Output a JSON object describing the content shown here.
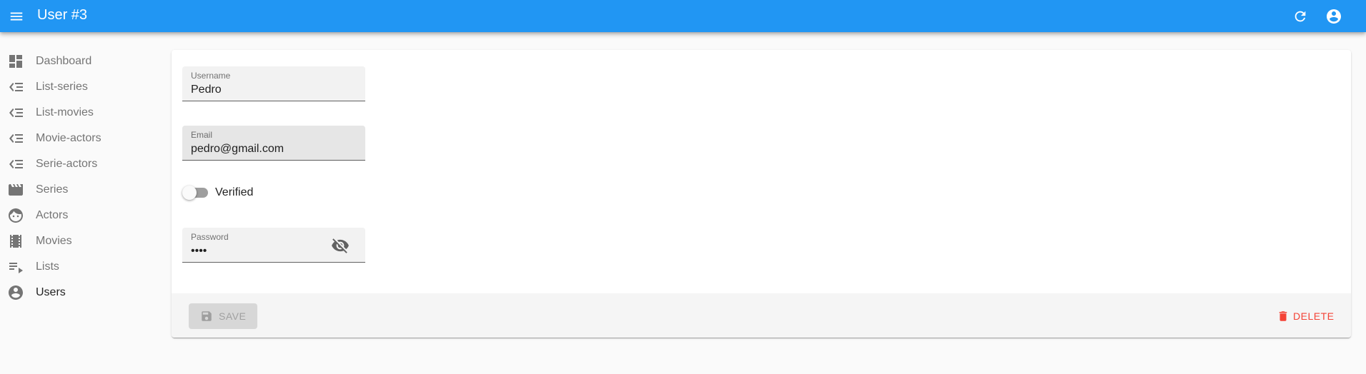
{
  "appbar": {
    "title": "User #3",
    "icons": {
      "menu": "menu-icon",
      "refresh": "refresh-icon",
      "account": "account-circle-icon"
    },
    "color": "#2196f3"
  },
  "sidebar": {
    "items": [
      {
        "label": "Dashboard",
        "icon": "dashboard-icon"
      },
      {
        "label": "List-series",
        "icon": "list-icon"
      },
      {
        "label": "List-movies",
        "icon": "list-icon"
      },
      {
        "label": "Movie-actors",
        "icon": "list-icon"
      },
      {
        "label": "Serie-actors",
        "icon": "list-icon"
      },
      {
        "label": "Series",
        "icon": "movie-clapper-icon"
      },
      {
        "label": "Actors",
        "icon": "face-icon"
      },
      {
        "label": "Movies",
        "icon": "film-strip-icon"
      },
      {
        "label": "Lists",
        "icon": "playlist-icon"
      },
      {
        "label": "Users",
        "icon": "account-circle-icon",
        "active": true
      }
    ]
  },
  "form": {
    "username": {
      "label": "Username",
      "value": "Pedro"
    },
    "email": {
      "label": "Email",
      "value": "pedro@gmail.com"
    },
    "verified": {
      "label": "Verified",
      "checked": false
    },
    "password": {
      "label": "Password",
      "value": "••••",
      "icon": "visibility-off-icon"
    }
  },
  "toolbar": {
    "save_label": "SAVE",
    "save_icon": "save-icon",
    "delete_label": "DELETE",
    "delete_icon": "trash-icon",
    "delete_color": "#f44336"
  }
}
